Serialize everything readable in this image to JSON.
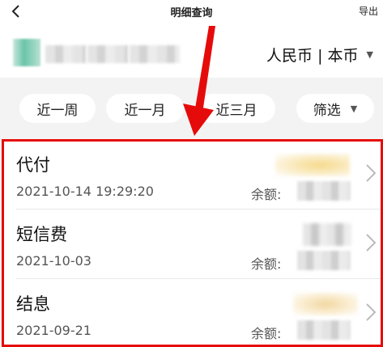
{
  "nav": {
    "title": "明细查询",
    "export_label": "导出",
    "back_icon": "chevron-left-icon"
  },
  "account": {
    "currency_label": "人民币 | 本币"
  },
  "filters": [
    {
      "label": "近一周"
    },
    {
      "label": "近一月"
    },
    {
      "label": "近三月"
    },
    {
      "label": "筛选"
    }
  ],
  "transactions": [
    {
      "title": "代付",
      "date": "2021-10-14 19:29:20",
      "balance_label": "余额:",
      "amount_tint": "#f5d98a"
    },
    {
      "title": "短信费",
      "date": "2021-10-03",
      "balance_label": "余额:",
      "amount_tint": "#cfcfcf"
    },
    {
      "title": "结息",
      "date": "2021-09-21",
      "balance_label": "余额:",
      "amount_tint": "#f2d7a0"
    }
  ],
  "annotation": {
    "color": "#e60b0b"
  }
}
